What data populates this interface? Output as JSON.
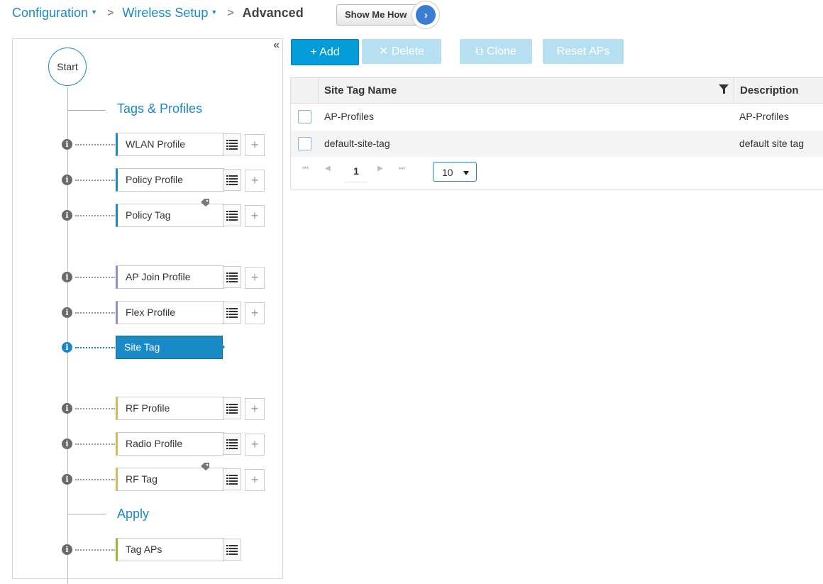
{
  "breadcrumb": {
    "item1": "Configuration",
    "item2": "Wireless Setup",
    "current": "Advanced",
    "caret": "▼",
    "separator": ">"
  },
  "show_me_how": {
    "label": "Show Me How",
    "arrow": "›"
  },
  "collapse_glyph": "«",
  "workflow": {
    "start_label": "Start",
    "section_tags": "Tags & Profiles",
    "section_apply": "Apply",
    "info_glyph": "i",
    "plus_glyph": "+",
    "items": [
      {
        "label": "WLAN Profile",
        "accent": "#1a8ac6"
      },
      {
        "label": "Policy Profile",
        "accent": "#1a8ac6"
      },
      {
        "label": "Policy Tag",
        "accent": "#1a8ac6"
      },
      {
        "label": "AP Join Profile",
        "accent": "#8a8fd6"
      },
      {
        "label": "Flex Profile",
        "accent": "#8a8fd6"
      },
      {
        "label": "Site Tag",
        "accent": "#1a8ac6"
      },
      {
        "label": "RF Profile",
        "accent": "#d9b65a"
      },
      {
        "label": "Radio Profile",
        "accent": "#d9b65a"
      },
      {
        "label": "RF Tag",
        "accent": "#d9b65a"
      },
      {
        "label": "Tag APs",
        "accent": "#9bb43a"
      }
    ]
  },
  "toolbar": {
    "add": "+ Add",
    "delete": "✕ Delete",
    "clone": "⧉ Clone",
    "reset": "Reset APs"
  },
  "table": {
    "columns": {
      "name": "Site Tag Name",
      "description": "Description"
    },
    "rows": [
      {
        "name": "AP-Profiles",
        "description": "AP-Profiles"
      },
      {
        "name": "default-site-tag",
        "description": "default site tag"
      }
    ],
    "pager": {
      "first": "⏮",
      "prev": "◀",
      "current_page": "1",
      "next": "▶",
      "last": "⏭",
      "page_size": "10"
    }
  }
}
